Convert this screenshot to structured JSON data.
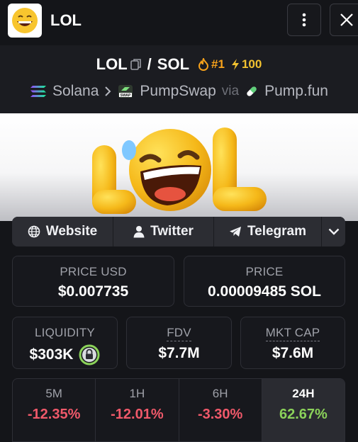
{
  "header": {
    "title": "LOL",
    "more_icon": "kebab-menu-icon",
    "close_icon": "close-icon"
  },
  "pair": {
    "base": "LOL",
    "separator": "/",
    "quote": "SOL",
    "rank": "#1",
    "boost": "100"
  },
  "chain": {
    "network": "Solana",
    "dex": "PumpSwap",
    "via": "via",
    "launchpad": "Pump.fun"
  },
  "socials": {
    "website": "Website",
    "twitter": "Twitter",
    "telegram": "Telegram"
  },
  "stats": {
    "price_usd": {
      "label": "PRICE USD",
      "value": "$0.007735"
    },
    "price": {
      "label": "PRICE",
      "value": "0.00009485 SOL"
    },
    "liquidity": {
      "label": "LIQUIDITY",
      "value": "$303K"
    },
    "fdv": {
      "label": "FDV",
      "value": "$7.7M"
    },
    "mkt_cap": {
      "label": "MKT CAP",
      "value": "$7.6M"
    }
  },
  "periods": [
    {
      "label": "5M",
      "value": "-12.35%"
    },
    {
      "label": "1H",
      "value": "-12.01%"
    },
    {
      "label": "6H",
      "value": "-3.30%"
    },
    {
      "label": "24H",
      "value": "62.67%"
    }
  ],
  "colors": {
    "negative": "#f0596a",
    "positive": "#8bd25a",
    "rank": "#f7a21b",
    "boost": "#f2c230"
  }
}
